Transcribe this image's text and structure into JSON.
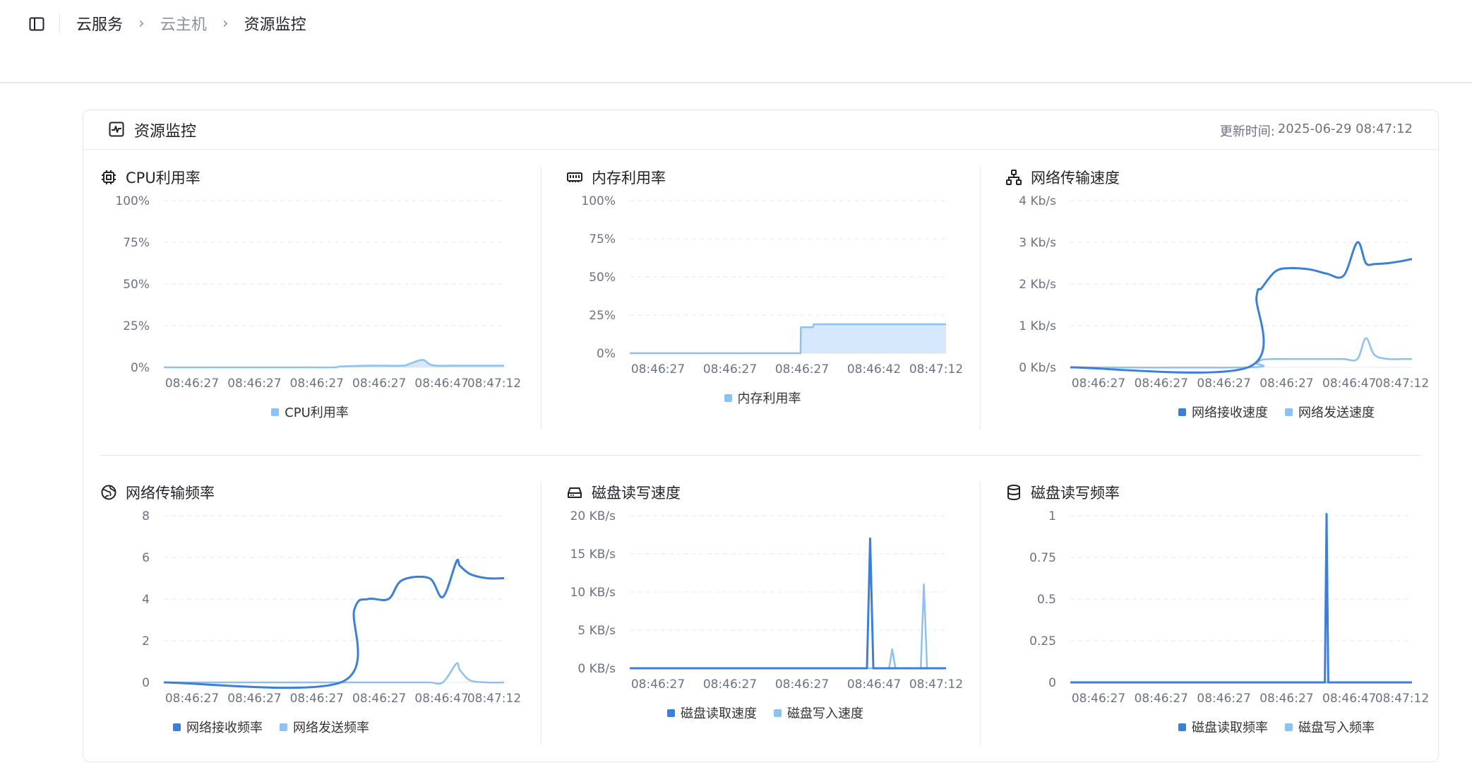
{
  "breadcrumb": {
    "items": [
      "云服务",
      "云主机",
      "资源监控"
    ],
    "separator": "›"
  },
  "card": {
    "title": "资源监控",
    "updated_label": "更新时间:",
    "updated_value": "2025-06-29 08:47:12"
  },
  "colors": {
    "primary": "#3b7fd9",
    "secondary": "#8ec0f0",
    "area_fill": "#cfe4fa",
    "grid": "#e5e7eb"
  },
  "chart_data": [
    {
      "id": "cpu",
      "title": "CPU利用率",
      "icon": "cpu-icon",
      "type": "area",
      "y_ticks": [
        "0%",
        "25%",
        "50%",
        "75%",
        "100%"
      ],
      "ylim": [
        0,
        100
      ],
      "x_ticks": [
        "08:46:27",
        "08:46:27",
        "08:46:27",
        "08:46:27",
        "08:46:47",
        "08:47:12"
      ],
      "x": [
        0,
        0.1,
        0.2,
        0.3,
        0.4,
        0.5,
        0.52,
        0.6,
        0.7,
        0.72,
        0.76,
        0.78,
        0.8,
        0.85,
        0.9,
        1
      ],
      "series": [
        {
          "name": "CPU利用率",
          "color": "secondary",
          "values": [
            0,
            0,
            0,
            0,
            0,
            0,
            0.5,
            1,
            1,
            2,
            4.5,
            2,
            1,
            1,
            1,
            1
          ]
        }
      ]
    },
    {
      "id": "memory",
      "title": "内存利用率",
      "icon": "memory-icon",
      "type": "area",
      "y_ticks": [
        "0%",
        "25%",
        "50%",
        "75%",
        "100%"
      ],
      "ylim": [
        0,
        100
      ],
      "x_ticks": [
        "08:46:27",
        "08:46:27",
        "08:46:27",
        "08:46:42",
        "08:47:12"
      ],
      "x": [
        0,
        0.54,
        0.541,
        0.58,
        0.581,
        1
      ],
      "step": true,
      "series": [
        {
          "name": "内存利用率",
          "color": "secondary",
          "values": [
            0,
            0,
            17,
            17,
            19,
            19
          ]
        }
      ]
    },
    {
      "id": "net-speed",
      "title": "网络传输速度",
      "icon": "network-icon",
      "type": "line",
      "y_ticks": [
        "0 Kb/s",
        "1 Kb/s",
        "2 Kb/s",
        "3 Kb/s",
        "4 Kb/s"
      ],
      "ylim": [
        0,
        4
      ],
      "x_ticks": [
        "08:46:27",
        "08:46:27",
        "08:46:27",
        "08:46:27",
        "08:46:47",
        "08:47:12"
      ],
      "x": [
        0,
        0.52,
        0.545,
        0.56,
        0.6,
        0.64,
        0.7,
        0.75,
        0.8,
        0.84,
        0.865,
        0.89,
        0.93,
        0.97,
        1
      ],
      "series": [
        {
          "name": "网络接收速度",
          "color": "primary",
          "values": [
            0,
            0,
            1.7,
            1.9,
            2.3,
            2.38,
            2.35,
            2.25,
            2.2,
            3.0,
            2.5,
            2.48,
            2.5,
            2.55,
            2.6
          ]
        },
        {
          "name": "网络发送速度",
          "color": "secondary",
          "values": [
            0,
            0,
            0.1,
            0.18,
            0.2,
            0.2,
            0.2,
            0.2,
            0.2,
            0.2,
            0.7,
            0.3,
            0.2,
            0.2,
            0.2
          ]
        }
      ]
    },
    {
      "id": "net-rate",
      "title": "网络传输频率",
      "icon": "globe-icon",
      "type": "line",
      "y_ticks": [
        "0",
        "2",
        "4",
        "6",
        "8"
      ],
      "ylim": [
        0,
        8
      ],
      "x_ticks": [
        "08:46:27",
        "08:46:27",
        "08:46:27",
        "08:46:27",
        "08:46:47",
        "08:47:12"
      ],
      "x": [
        0,
        0.52,
        0.56,
        0.6,
        0.66,
        0.7,
        0.78,
        0.82,
        0.86,
        0.87,
        0.9,
        0.95,
        1
      ],
      "series": [
        {
          "name": "网络接收频率",
          "color": "primary",
          "values": [
            0,
            0,
            3.5,
            4,
            4,
            4.9,
            5,
            4.1,
            5.8,
            5.6,
            5.2,
            5,
            5
          ]
        },
        {
          "name": "网络发送频率",
          "color": "secondary",
          "values": [
            0,
            0,
            0,
            0,
            0,
            0,
            0,
            0,
            0.9,
            0.6,
            0.1,
            0,
            0
          ]
        }
      ]
    },
    {
      "id": "disk-speed",
      "title": "磁盘读写速度",
      "icon": "disk-icon",
      "type": "line",
      "y_ticks": [
        "0 KB/s",
        "5 KB/s",
        "10 KB/s",
        "15 KB/s",
        "20 KB/s"
      ],
      "ylim": [
        0,
        20
      ],
      "x_ticks": [
        "08:46:27",
        "08:46:27",
        "08:46:27",
        "08:46:47",
        "08:47:12"
      ],
      "x": [
        0,
        0.75,
        0.76,
        0.77,
        0.82,
        0.83,
        0.84,
        0.92,
        0.93,
        0.94,
        1
      ],
      "series": [
        {
          "name": "磁盘读取速度",
          "color": "primary",
          "values": [
            0,
            0,
            17,
            0,
            0,
            0,
            0,
            0,
            0,
            0,
            0
          ]
        },
        {
          "name": "磁盘写入速度",
          "color": "secondary",
          "values": [
            0,
            0,
            0,
            0,
            0,
            2.5,
            0,
            0,
            11,
            0,
            0
          ]
        }
      ]
    },
    {
      "id": "disk-rate",
      "title": "磁盘读写频率",
      "icon": "database-icon",
      "type": "line",
      "y_ticks": [
        "0",
        "0.25",
        "0.5",
        "0.75",
        "1"
      ],
      "ylim": [
        0,
        1
      ],
      "x_ticks": [
        "08:46:27",
        "08:46:27",
        "08:46:27",
        "08:46:27",
        "08:46:47",
        "08:47:12"
      ],
      "x": [
        0,
        0.745,
        0.75,
        0.755,
        1
      ],
      "series": [
        {
          "name": "磁盘读取频率",
          "color": "primary",
          "values": [
            0,
            0,
            1.01,
            0,
            0
          ]
        },
        {
          "name": "磁盘写入频率",
          "color": "secondary",
          "values": [
            0,
            0,
            0,
            0,
            0
          ]
        }
      ]
    }
  ]
}
